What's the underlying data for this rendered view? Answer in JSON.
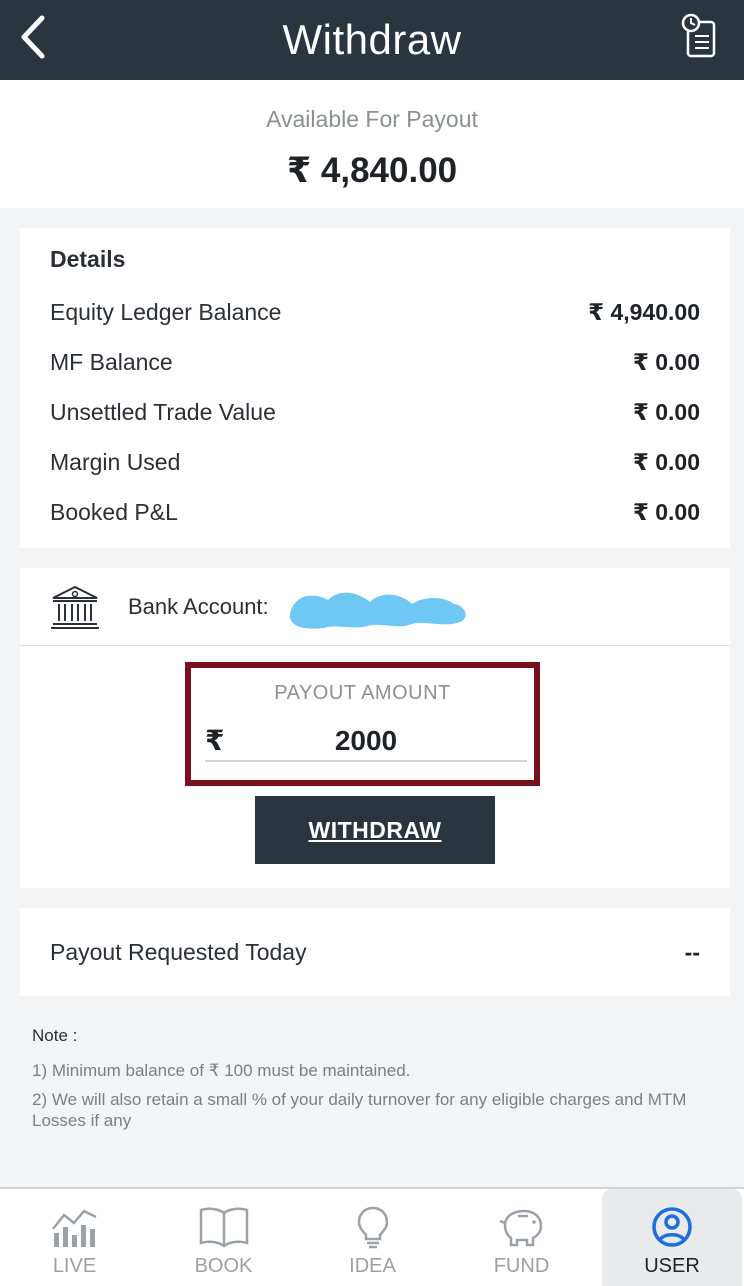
{
  "header": {
    "title": "Withdraw",
    "back_icon": "chevron-left-icon",
    "history_icon": "history-list-icon"
  },
  "available": {
    "label": "Available For Payout",
    "amount": "₹ 4,840.00"
  },
  "details": {
    "heading": "Details",
    "rows": [
      {
        "label": "Equity Ledger Balance",
        "value": "₹ 4,940.00"
      },
      {
        "label": "MF Balance",
        "value": "₹ 0.00"
      },
      {
        "label": "Unsettled Trade Value",
        "value": "₹ 0.00"
      },
      {
        "label": "Margin Used",
        "value": "₹ 0.00"
      },
      {
        "label": "Booked P&L",
        "value": "₹ 0.00"
      }
    ]
  },
  "bank": {
    "label": "Bank Account:",
    "icon": "bank-icon",
    "redaction_color": "#6fc8f4"
  },
  "payout": {
    "label": "PAYOUT AMOUNT",
    "currency": "₹",
    "amount": "2000",
    "highlight_color": "#7a0f1e"
  },
  "withdraw_button": {
    "label": "WITHDRAW"
  },
  "requested": {
    "label": "Payout Requested Today",
    "value": "--"
  },
  "notes": {
    "title": "Note :",
    "lines": [
      "1) Minimum balance of ₹ 100 must be maintained.",
      "2) We will also retain a small % of your daily turnover for any eligible charges and MTM Losses if any"
    ]
  },
  "nav": {
    "items": [
      {
        "label": "LIVE",
        "icon": "chart-bars-icon"
      },
      {
        "label": "BOOK",
        "icon": "book-icon"
      },
      {
        "label": "IDEA",
        "icon": "bulb-icon"
      },
      {
        "label": "FUND",
        "icon": "piggy-bank-icon"
      },
      {
        "label": "USER",
        "icon": "user-icon",
        "active": true
      }
    ]
  },
  "colors": {
    "header_bg": "#2a3540",
    "accent_blue": "#1e6fd9",
    "page_bg": "#f3f4f6"
  }
}
